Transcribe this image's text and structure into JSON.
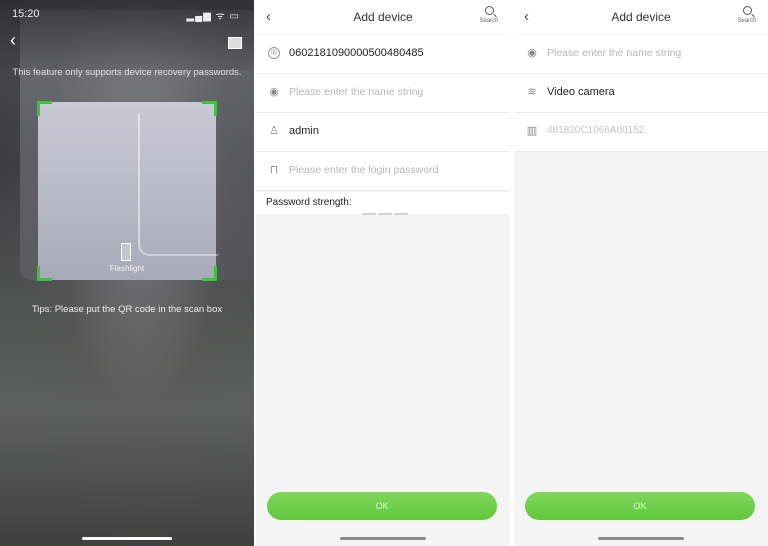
{
  "scanner": {
    "status_time": "15:20",
    "status_icons": "▂▄▆ ᯤ ▭",
    "back_icon": "chevron-left-icon",
    "album_icon": "image-icon",
    "notice": "This feature only supports device recovery passwords.",
    "flashlight_label": "Flashlight",
    "tips": "Tips: Please put the QR code in the scan box",
    "accent": "#3ec33e"
  },
  "form1": {
    "title": "Add device",
    "search_label": "Search",
    "serial": "0602181090000500480485",
    "name_placeholder": "Please enter the name string",
    "username": "admin",
    "password_placeholder": "Please enter the login password",
    "strength_label": "Password strength:",
    "ok_label": "OK"
  },
  "form2": {
    "title": "Add device",
    "search_label": "Search",
    "name_placeholder": "Please enter the name string",
    "device_type": "Video camera",
    "device_id": "481820C1066A00152",
    "ok_label": "OK"
  },
  "colors": {
    "button_green": "#62c83c",
    "placeholder_gray": "#b6b6b6"
  }
}
